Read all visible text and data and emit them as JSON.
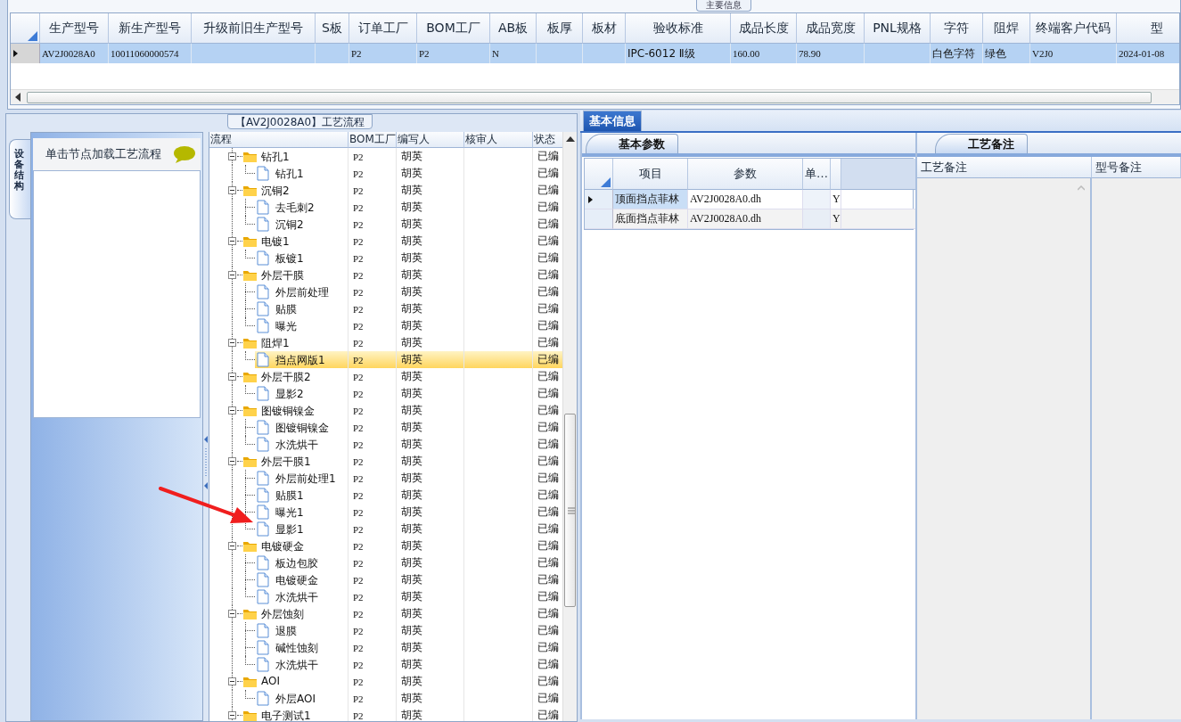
{
  "main_info": {
    "title": "主要信息",
    "columns": [
      {
        "label": "生产型号",
        "value": "AV2J0028A0"
      },
      {
        "label": "新生产型号",
        "value": "10011060000574"
      },
      {
        "label": "升级前旧生产型号"
      },
      {
        "label": "S板"
      },
      {
        "label": "订单工厂",
        "value": "P2"
      },
      {
        "label": "BOM工厂",
        "value": "P2"
      },
      {
        "label": "AB板",
        "value": "N"
      },
      {
        "label": "板厚"
      },
      {
        "label": "板材"
      },
      {
        "label": "验收标准",
        "value": "IPC-6012 Ⅱ级"
      },
      {
        "label": "成品长度",
        "value": "160.00"
      },
      {
        "label": "成品宽度",
        "value": "78.90"
      },
      {
        "label": "PNL规格"
      },
      {
        "label": "字符",
        "value": "白色字符"
      },
      {
        "label": "阻焊",
        "value": "绿色"
      },
      {
        "label": "终端客户代码",
        "value": "V2J0"
      },
      {
        "label": "型",
        "value": "2024-01-08"
      }
    ],
    "row_selected": true
  },
  "process_panel": {
    "title": "【AV2J0028A0】工艺流程",
    "side_tab": "设备结构",
    "hint": "单击节点加载工艺流程",
    "tree": {
      "columns": [
        "流程",
        "BOM工厂",
        "编写人",
        "核审人",
        "状态"
      ],
      "nodes": [
        {
          "name": "钻孔1",
          "bom": "P2",
          "writer": "胡英",
          "status": "已编",
          "expanded": true,
          "selected": false,
          "children": [
            {
              "name": "钻孔1",
              "bom": "P2",
              "writer": "胡英",
              "status": "已编",
              "selected": false
            }
          ]
        },
        {
          "name": "沉铜2",
          "bom": "P2",
          "writer": "胡英",
          "status": "已编",
          "expanded": true,
          "selected": false,
          "children": [
            {
              "name": "去毛刺2",
              "bom": "P2",
              "writer": "胡英",
              "status": "已编",
              "selected": false
            },
            {
              "name": "沉铜2",
              "bom": "P2",
              "writer": "胡英",
              "status": "已编",
              "selected": false
            }
          ]
        },
        {
          "name": "电镀1",
          "bom": "P2",
          "writer": "胡英",
          "status": "已编",
          "expanded": true,
          "selected": false,
          "children": [
            {
              "name": "板镀1",
              "bom": "P2",
              "writer": "胡英",
              "status": "已编",
              "selected": false
            }
          ]
        },
        {
          "name": "外层干膜",
          "bom": "P2",
          "writer": "胡英",
          "status": "已编",
          "expanded": true,
          "selected": false,
          "children": [
            {
              "name": "外层前处理",
              "bom": "P2",
              "writer": "胡英",
              "status": "已编",
              "selected": false
            },
            {
              "name": "贴膜",
              "bom": "P2",
              "writer": "胡英",
              "status": "已编",
              "selected": false
            },
            {
              "name": "曝光",
              "bom": "P2",
              "writer": "胡英",
              "status": "已编",
              "selected": false
            }
          ]
        },
        {
          "name": "阻焊1",
          "bom": "P2",
          "writer": "胡英",
          "status": "已编",
          "expanded": true,
          "selected": false,
          "children": [
            {
              "name": "挡点网版1",
              "bom": "P2",
              "writer": "胡英",
              "status": "已编",
              "selected": true
            }
          ]
        },
        {
          "name": "外层干膜2",
          "bom": "P2",
          "writer": "胡英",
          "status": "已编",
          "expanded": true,
          "selected": false,
          "children": [
            {
              "name": "显影2",
              "bom": "P2",
              "writer": "胡英",
              "status": "已编",
              "selected": false
            }
          ]
        },
        {
          "name": "图镀铜镍金",
          "bom": "P2",
          "writer": "胡英",
          "status": "已编",
          "expanded": true,
          "selected": false,
          "children": [
            {
              "name": "图镀铜镍金",
              "bom": "P2",
              "writer": "胡英",
              "status": "已编",
              "selected": false
            },
            {
              "name": "水洗烘干",
              "bom": "P2",
              "writer": "胡英",
              "status": "已编",
              "selected": false
            }
          ]
        },
        {
          "name": "外层干膜1",
          "bom": "P2",
          "writer": "胡英",
          "status": "已编",
          "expanded": true,
          "selected": false,
          "children": [
            {
              "name": "外层前处理1",
              "bom": "P2",
              "writer": "胡英",
              "status": "已编",
              "selected": false
            },
            {
              "name": "贴膜1",
              "bom": "P2",
              "writer": "胡英",
              "status": "已编",
              "selected": false
            },
            {
              "name": "曝光1",
              "bom": "P2",
              "writer": "胡英",
              "status": "已编",
              "selected": false
            },
            {
              "name": "显影1",
              "bom": "P2",
              "writer": "胡英",
              "status": "已编",
              "selected": false
            }
          ]
        },
        {
          "name": "电镀硬金",
          "bom": "P2",
          "writer": "胡英",
          "status": "已编",
          "expanded": true,
          "selected": false,
          "children": [
            {
              "name": "板边包胶",
              "bom": "P2",
              "writer": "胡英",
              "status": "已编",
              "selected": false
            },
            {
              "name": "电镀硬金",
              "bom": "P2",
              "writer": "胡英",
              "status": "已编",
              "selected": false
            },
            {
              "name": "水洗烘干",
              "bom": "P2",
              "writer": "胡英",
              "status": "已编",
              "selected": false
            }
          ]
        },
        {
          "name": "外层蚀刻",
          "bom": "P2",
          "writer": "胡英",
          "status": "已编",
          "expanded": true,
          "selected": false,
          "children": [
            {
              "name": "退膜",
              "bom": "P2",
              "writer": "胡英",
              "status": "已编",
              "selected": false
            },
            {
              "name": "碱性蚀刻",
              "bom": "P2",
              "writer": "胡英",
              "status": "已编",
              "selected": false
            },
            {
              "name": "水洗烘干",
              "bom": "P2",
              "writer": "胡英",
              "status": "已编",
              "selected": false
            }
          ]
        },
        {
          "name": "AOI",
          "bom": "P2",
          "writer": "胡英",
          "status": "已编",
          "expanded": true,
          "selected": false,
          "children": [
            {
              "name": "外层AOI",
              "bom": "P2",
              "writer": "胡英",
              "status": "已编",
              "selected": false
            }
          ]
        },
        {
          "name": "电子测试1",
          "bom": "P2",
          "writer": "胡英",
          "status": "已编",
          "expanded": true,
          "selected": false
        }
      ]
    }
  },
  "info_tab": {
    "label": "基本信息",
    "selected": true
  },
  "params": {
    "tab": "基本参数",
    "columns": [
      "项目",
      "参数",
      "单…"
    ],
    "rows": [
      {
        "item": "顶面挡点菲林",
        "value": "AV2J0028A0.dh",
        "flag": "Y",
        "current": true
      },
      {
        "item": "底面挡点菲林",
        "value": "AV2J0028A0.dh",
        "flag": "Y",
        "current": false
      }
    ]
  },
  "notes": {
    "tab": "工艺备注",
    "columns": [
      "工艺备注",
      "型号备注"
    ]
  }
}
